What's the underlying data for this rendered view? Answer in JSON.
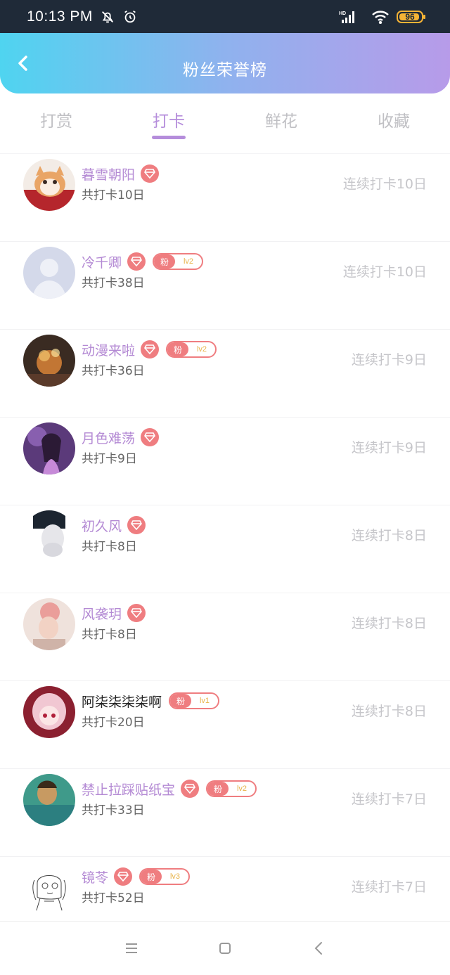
{
  "status_bar": {
    "time": "10:13 PM",
    "icons": [
      "bell-off-icon",
      "alarm-icon",
      "hd-signal-icon",
      "wifi-icon"
    ],
    "battery": "96",
    "battery_color": "#f5b335"
  },
  "header": {
    "title": "粉丝荣誉榜",
    "back_icon": "chevron-left-icon",
    "gradient": [
      "#4fd4f0",
      "#8fb2ee",
      "#b79be9"
    ]
  },
  "tabs": [
    {
      "label": "打赏",
      "active": false
    },
    {
      "label": "打卡",
      "active": true
    },
    {
      "label": "鲜花",
      "active": false
    },
    {
      "label": "收藏",
      "active": false
    }
  ],
  "accent_color": "#b58ddb",
  "badge_color": "#ef7d80",
  "rows": [
    {
      "name": "暮雪朝阳",
      "vip": true,
      "fan_label": "",
      "fan_level": "",
      "total": "共打卡10日",
      "streak": "连续打卡10日"
    },
    {
      "name": "冷千卿",
      "vip": true,
      "fan_label": "粉",
      "fan_level": "lv2",
      "total": "共打卡38日",
      "streak": "连续打卡10日"
    },
    {
      "name": "动漫来啦",
      "vip": true,
      "fan_label": "粉",
      "fan_level": "lv2",
      "total": "共打卡36日",
      "streak": "连续打卡9日"
    },
    {
      "name": "月色难荡",
      "vip": true,
      "fan_label": "",
      "fan_level": "",
      "total": "共打卡9日",
      "streak": "连续打卡9日"
    },
    {
      "name": "初久风",
      "vip": true,
      "fan_label": "",
      "fan_level": "",
      "total": "共打卡8日",
      "streak": "连续打卡8日"
    },
    {
      "name": "风袭玥",
      "vip": true,
      "fan_label": "",
      "fan_level": "",
      "total": "共打卡8日",
      "streak": "连续打卡8日"
    },
    {
      "name": "阿柒柒柒柒啊",
      "vip": false,
      "fan_label": "粉",
      "fan_level": "lv1",
      "total": "共打卡20日",
      "streak": "连续打卡8日"
    },
    {
      "name": "禁止拉踩贴纸宝",
      "vip": true,
      "fan_label": "粉",
      "fan_level": "lv2",
      "total": "共打卡33日",
      "streak": "连续打卡7日"
    },
    {
      "name": "镜苓",
      "vip": true,
      "fan_label": "粉",
      "fan_level": "lv3",
      "total": "共打卡52日",
      "streak": "连续打卡7日"
    }
  ],
  "nav_bar": {
    "icons": [
      "menu-icon",
      "home-square-icon",
      "back-chevron-icon"
    ]
  }
}
